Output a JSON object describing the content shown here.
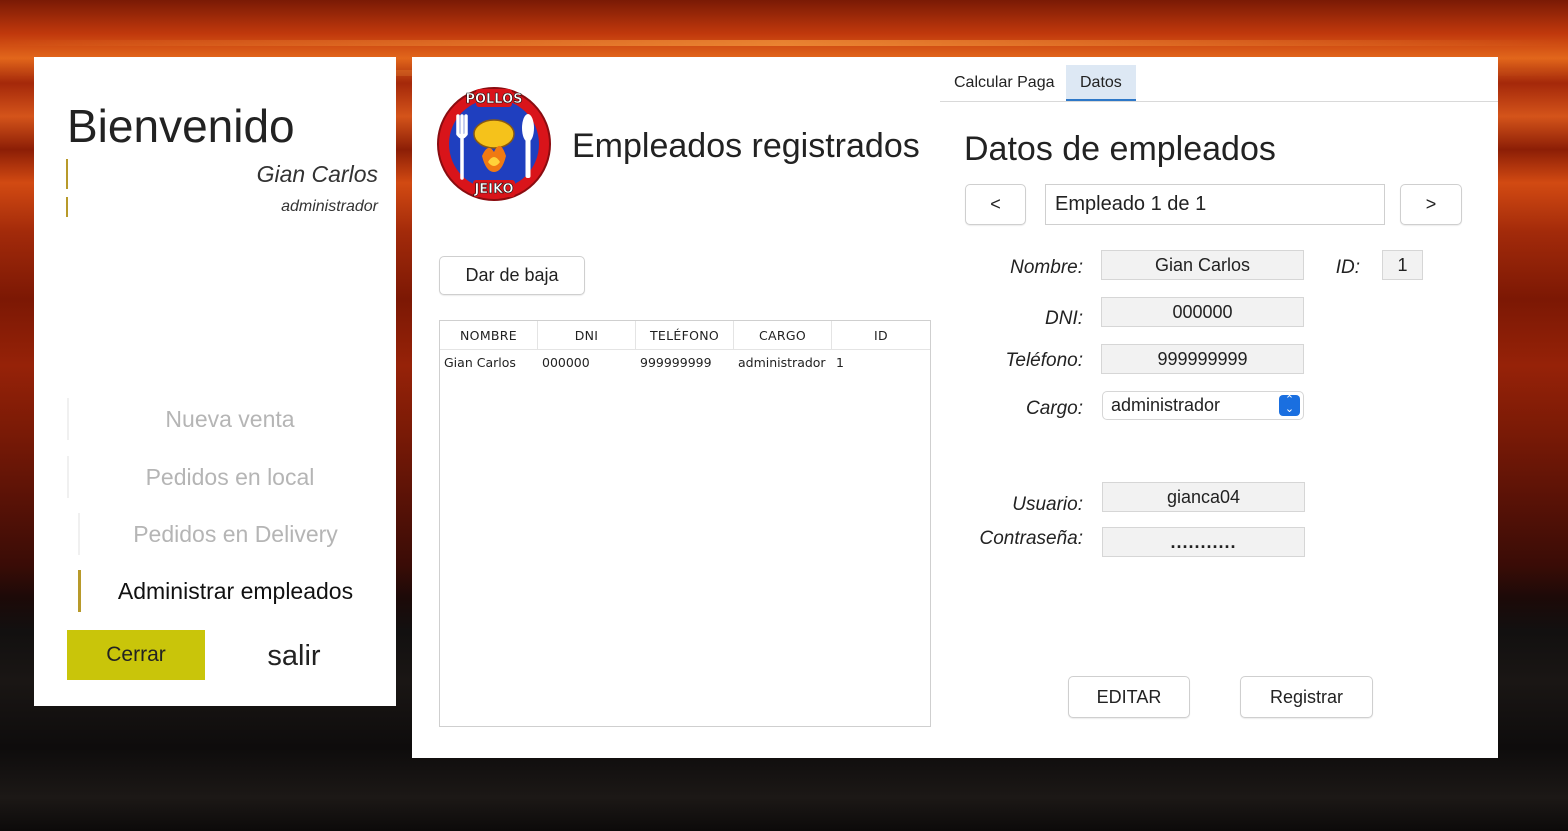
{
  "sidebar": {
    "welcome": "Bienvenido",
    "user_name": "Gian Carlos",
    "user_role": "administrador",
    "nav": {
      "new_sale": "Nueva venta",
      "local_orders": "Pedidos en local",
      "delivery_orders": "Pedidos en Delivery",
      "manage_employees": "Administrar empleados"
    },
    "close_label": "Cerrar",
    "exit_label": "salir"
  },
  "logo": {
    "top_text": "POLLOS",
    "bottom_text": "JEIKO",
    "colors": {
      "ring": "#d9141a",
      "inner": "#1f3fbf",
      "flame": "#f07a12"
    }
  },
  "employees": {
    "title": "Empleados registrados",
    "dismiss_label": "Dar de baja",
    "columns": [
      "NOMBRE",
      "DNI",
      "TELÉFONO",
      "CARGO",
      "ID"
    ],
    "rows": [
      [
        "Gian Carlos",
        "000000",
        "999999999",
        "administrador",
        "1"
      ]
    ]
  },
  "tabs": {
    "calc_pay": "Calcular Paga",
    "data": "Datos",
    "active": "Datos"
  },
  "details": {
    "title": "Datos de empleados",
    "prev_label": "<",
    "next_label": ">",
    "record_indicator": "Empleado 1 de 1",
    "labels": {
      "name": "Nombre:",
      "id": "ID:",
      "dni": "DNI:",
      "phone": "Teléfono:",
      "role": "Cargo:",
      "user": "Usuario:",
      "password": "Contraseña:"
    },
    "values": {
      "name": "Gian Carlos",
      "id": "1",
      "dni": "000000",
      "phone": "999999999",
      "role": "administrador",
      "user": "gianca04",
      "password": "..........."
    },
    "edit_label": "EDITAR",
    "register_label": "Registrar"
  },
  "colors": {
    "accent_yellow": "#c9c50a",
    "accent_gold": "#b89a2a",
    "tab_active_bg": "#dde8f4",
    "tab_active_border": "#2e78c8",
    "select_arrow": "#1a6fe0"
  }
}
